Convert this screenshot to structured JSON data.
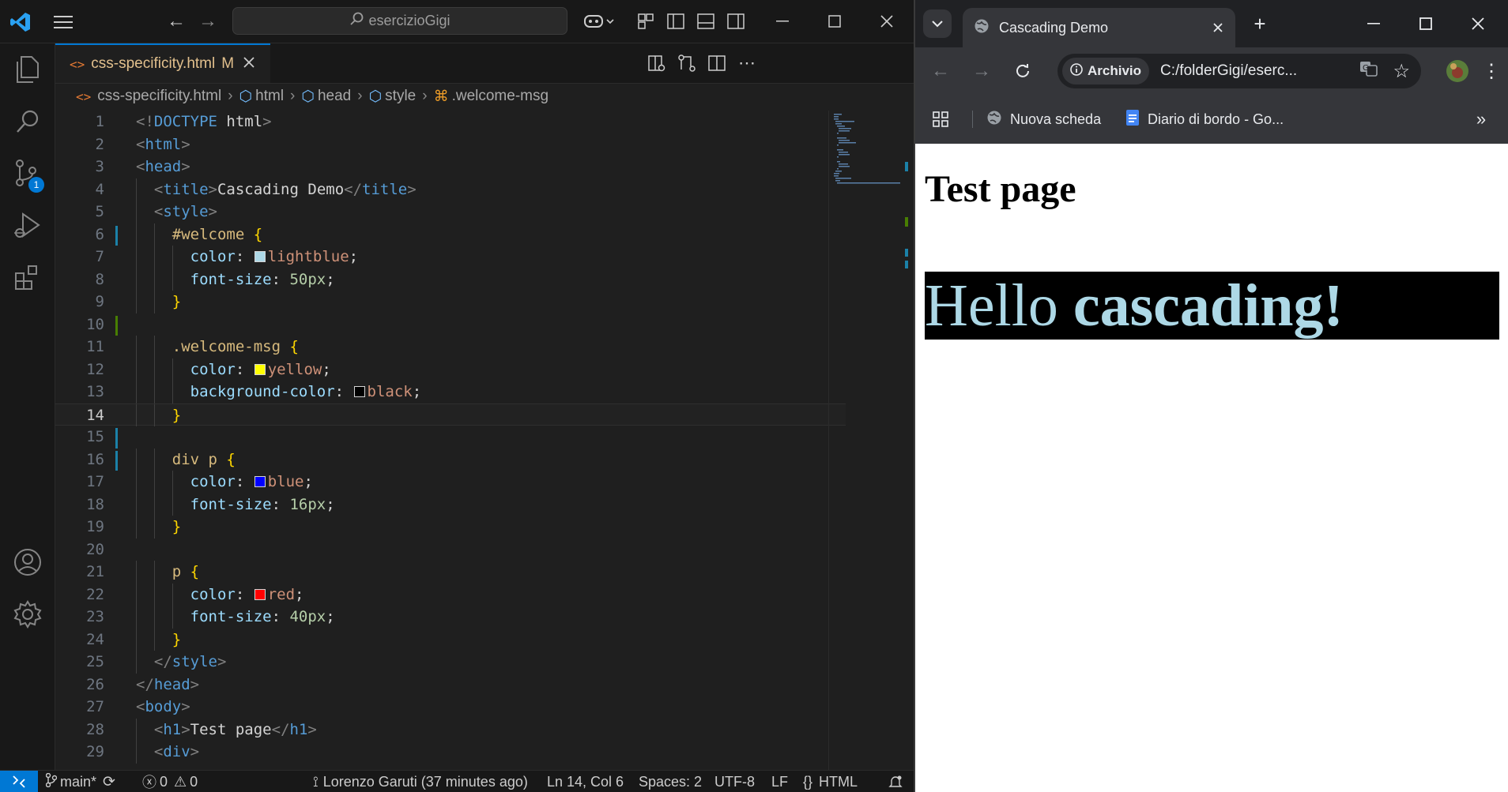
{
  "vscode": {
    "search_text": "esercizioGigi",
    "tab": {
      "filename": "css-specificity.html",
      "status": "M"
    },
    "breadcrumb": [
      "css-specificity.html",
      "html",
      "head",
      "style",
      ".welcome-msg"
    ],
    "scm_badge": "1",
    "current_line": 14,
    "code_lines": [
      {
        "n": 1,
        "t": [
          [
            "<!",
            "pun"
          ],
          [
            "DOCTYPE",
            "tag"
          ],
          [
            " html",
            "txt"
          ],
          [
            ">",
            "pun"
          ]
        ]
      },
      {
        "n": 2,
        "t": [
          [
            "<",
            "pun"
          ],
          [
            "html",
            "tag"
          ],
          [
            ">",
            "pun"
          ]
        ]
      },
      {
        "n": 3,
        "t": [
          [
            "<",
            "pun"
          ],
          [
            "head",
            "tag"
          ],
          [
            ">",
            "pun"
          ]
        ]
      },
      {
        "n": 4,
        "i": 1,
        "t": [
          [
            "<",
            "pun"
          ],
          [
            "title",
            "tag"
          ],
          [
            ">",
            "pun"
          ],
          [
            "Cascading Demo",
            "txt"
          ],
          [
            "</",
            "pun"
          ],
          [
            "title",
            "tag"
          ],
          [
            ">",
            "pun"
          ]
        ]
      },
      {
        "n": 5,
        "i": 1,
        "t": [
          [
            "<",
            "pun"
          ],
          [
            "style",
            "tag"
          ],
          [
            ">",
            "pun"
          ]
        ]
      },
      {
        "n": 6,
        "i": 2,
        "t": [
          [
            "#welcome",
            "sel"
          ],
          [
            " ",
            "txt"
          ],
          [
            "{",
            "brk"
          ]
        ]
      },
      {
        "n": 7,
        "i": 3,
        "t": [
          [
            "color",
            "prop"
          ],
          [
            ": ",
            "txt"
          ],
          [
            "@#add8e6",
            "sw"
          ],
          [
            "lightblue",
            "val"
          ],
          [
            ";",
            "txt"
          ]
        ]
      },
      {
        "n": 8,
        "i": 3,
        "t": [
          [
            "font-size",
            "prop"
          ],
          [
            ": ",
            "txt"
          ],
          [
            "50px",
            "num"
          ],
          [
            ";",
            "txt"
          ]
        ]
      },
      {
        "n": 9,
        "i": 2,
        "t": [
          [
            "}",
            "brk"
          ]
        ]
      },
      {
        "n": 10,
        "t": []
      },
      {
        "n": 11,
        "i": 2,
        "t": [
          [
            ".welcome-msg",
            "sel"
          ],
          [
            " ",
            "txt"
          ],
          [
            "{",
            "brk"
          ]
        ]
      },
      {
        "n": 12,
        "i": 3,
        "t": [
          [
            "color",
            "prop"
          ],
          [
            ": ",
            "txt"
          ],
          [
            "@#ffff00",
            "sw"
          ],
          [
            "yellow",
            "val"
          ],
          [
            ";",
            "txt"
          ]
        ]
      },
      {
        "n": 13,
        "i": 3,
        "t": [
          [
            "background-color",
            "prop"
          ],
          [
            ": ",
            "txt"
          ],
          [
            "@#000000",
            "sw"
          ],
          [
            "black",
            "val"
          ],
          [
            ";",
            "txt"
          ]
        ]
      },
      {
        "n": 14,
        "i": 2,
        "t": [
          [
            "}",
            "brk"
          ]
        ]
      },
      {
        "n": 15,
        "t": []
      },
      {
        "n": 16,
        "i": 2,
        "t": [
          [
            "div p",
            "sel"
          ],
          [
            " ",
            "txt"
          ],
          [
            "{",
            "brk"
          ]
        ]
      },
      {
        "n": 17,
        "i": 3,
        "t": [
          [
            "color",
            "prop"
          ],
          [
            ": ",
            "txt"
          ],
          [
            "@#0000ff",
            "sw"
          ],
          [
            "blue",
            "val"
          ],
          [
            ";",
            "txt"
          ]
        ]
      },
      {
        "n": 18,
        "i": 3,
        "t": [
          [
            "font-size",
            "prop"
          ],
          [
            ": ",
            "txt"
          ],
          [
            "16px",
            "num"
          ],
          [
            ";",
            "txt"
          ]
        ]
      },
      {
        "n": 19,
        "i": 2,
        "t": [
          [
            "}",
            "brk"
          ]
        ]
      },
      {
        "n": 20,
        "t": []
      },
      {
        "n": 21,
        "i": 2,
        "t": [
          [
            "p",
            "sel"
          ],
          [
            " ",
            "txt"
          ],
          [
            "{",
            "brk"
          ]
        ]
      },
      {
        "n": 22,
        "i": 3,
        "t": [
          [
            "color",
            "prop"
          ],
          [
            ": ",
            "txt"
          ],
          [
            "@#ff0000",
            "sw"
          ],
          [
            "red",
            "val"
          ],
          [
            ";",
            "txt"
          ]
        ]
      },
      {
        "n": 23,
        "i": 3,
        "t": [
          [
            "font-size",
            "prop"
          ],
          [
            ": ",
            "txt"
          ],
          [
            "40px",
            "num"
          ],
          [
            ";",
            "txt"
          ]
        ]
      },
      {
        "n": 24,
        "i": 2,
        "t": [
          [
            "}",
            "brk"
          ]
        ]
      },
      {
        "n": 25,
        "i": 1,
        "t": [
          [
            "</",
            "pun"
          ],
          [
            "style",
            "tag"
          ],
          [
            ">",
            "pun"
          ]
        ]
      },
      {
        "n": 26,
        "t": [
          [
            "</",
            "pun"
          ],
          [
            "head",
            "tag"
          ],
          [
            ">",
            "pun"
          ]
        ]
      },
      {
        "n": 27,
        "t": [
          [
            "<",
            "pun"
          ],
          [
            "body",
            "tag"
          ],
          [
            ">",
            "pun"
          ]
        ]
      },
      {
        "n": 28,
        "i": 1,
        "t": [
          [
            "<",
            "pun"
          ],
          [
            "h1",
            "tag"
          ],
          [
            ">",
            "pun"
          ],
          [
            "Test page",
            "txt"
          ],
          [
            "</",
            "pun"
          ],
          [
            "h1",
            "tag"
          ],
          [
            ">",
            "pun"
          ]
        ]
      },
      {
        "n": 29,
        "i": 1,
        "t": [
          [
            "<",
            "pun"
          ],
          [
            "div",
            "tag"
          ],
          [
            ">",
            "pun"
          ]
        ]
      }
    ],
    "status": {
      "branch": "main*",
      "errors": "0",
      "warnings": "0",
      "blame": "Lorenzo Garuti (37 minutes ago)",
      "position": "Ln 14, Col 6",
      "spaces": "Spaces: 2",
      "encoding": "UTF-8",
      "eol": "LF",
      "language": "HTML"
    }
  },
  "chrome": {
    "tab_title": "Cascading Demo",
    "site_label": "Archivio",
    "url": "C:/folderGigi/eserc...",
    "bookmarks": [
      "Nuova scheda",
      "Diario di bordo - Go..."
    ],
    "page": {
      "heading": "Test page",
      "para_plain": "Hello ",
      "para_bold": "cascading!"
    }
  },
  "colors": {
    "accent": "#0078d4",
    "modified_tab": "#e2c08d",
    "heading_text": "#000000",
    "para_text": "#add8e6",
    "para_bg": "#000000"
  }
}
